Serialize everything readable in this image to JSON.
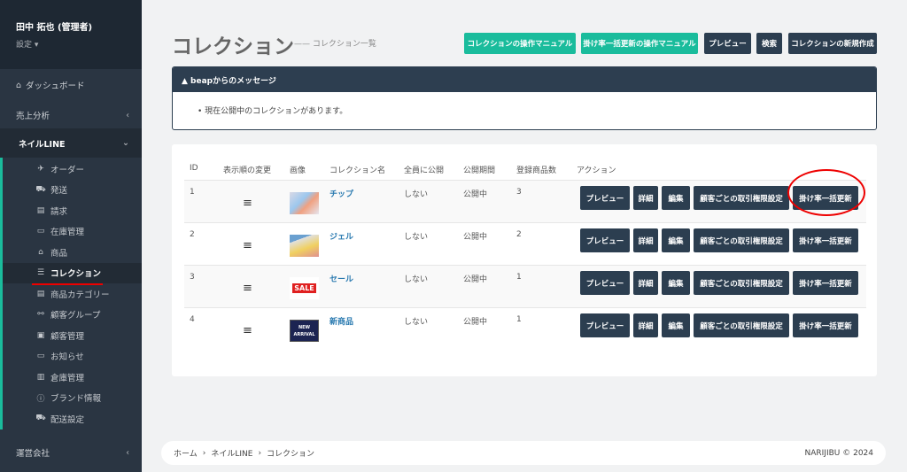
{
  "user": {
    "name": "田中 拓也 (管理者)",
    "settings": "設定 ▾"
  },
  "nav": {
    "dashboard": "ダッシュボード",
    "sales": "売上分析",
    "group": "ネイルLINE",
    "company": "運営会社",
    "sub": [
      {
        "icon": "paper-plane-icon",
        "glyph": "✈",
        "label": "オーダー"
      },
      {
        "icon": "truck-icon",
        "glyph": "⛟",
        "label": "発送"
      },
      {
        "icon": "file-icon",
        "glyph": "▤",
        "label": "請求"
      },
      {
        "icon": "laptop-icon",
        "glyph": "▭",
        "label": "在庫管理"
      },
      {
        "icon": "bag-icon",
        "glyph": "⌂",
        "label": "商品"
      },
      {
        "icon": "list-icon",
        "glyph": "☰",
        "label": "コレクション"
      },
      {
        "icon": "tag-icon",
        "glyph": "▤",
        "label": "商品カテゴリー"
      },
      {
        "icon": "sitemap-icon",
        "glyph": "⚯",
        "label": "顧客グループ"
      },
      {
        "icon": "contact-icon",
        "glyph": "▣",
        "label": "顧客管理"
      },
      {
        "icon": "laptop-icon",
        "glyph": "▭",
        "label": "お知らせ"
      },
      {
        "icon": "building-icon",
        "glyph": "▥",
        "label": "倉庫管理"
      },
      {
        "icon": "info-icon",
        "glyph": "ⓘ",
        "label": "ブランド情報"
      },
      {
        "icon": "truck-icon",
        "glyph": "⛟",
        "label": "配送設定"
      }
    ]
  },
  "header": {
    "title": "コレクション",
    "subtitle": "—— コレクション一覧",
    "buttons": [
      "コレクションの操作マニュアル",
      "掛け率一括更新の操作マニュアル",
      "プレビュー",
      "検索",
      "コレクションの新規作成"
    ]
  },
  "message": {
    "title": "▲ beapからのメッセージ",
    "items": [
      "現在公開中のコレクションがあります。"
    ]
  },
  "table": {
    "headers": [
      "ID",
      "表示順の変更",
      "画像",
      "コレクション名",
      "全員に公開",
      "公開期間",
      "登録商品数",
      "アクション"
    ],
    "rows": [
      {
        "id": "1",
        "name": "チップ",
        "public": "しない",
        "period": "公開中",
        "count": "3"
      },
      {
        "id": "2",
        "name": "ジェル",
        "public": "しない",
        "period": "公開中",
        "count": "2"
      },
      {
        "id": "3",
        "name": "セール",
        "public": "しない",
        "period": "公開中",
        "count": "1"
      },
      {
        "id": "4",
        "name": "新商品",
        "public": "しない",
        "period": "公開中",
        "count": "1"
      }
    ],
    "actions": [
      "プレビュー",
      "詳細",
      "編集",
      "顧客ごとの取引権限設定",
      "掛け率一括更新"
    ],
    "thumb_texts": {
      "sale": "SALE",
      "new1": "NEW",
      "new2": "ARRIVAL"
    }
  },
  "footer": {
    "crumbs": [
      "ホーム",
      "ネイルLINE",
      "コレクション"
    ],
    "sep": "›",
    "copyright": "NARIJIBU © 2024"
  }
}
